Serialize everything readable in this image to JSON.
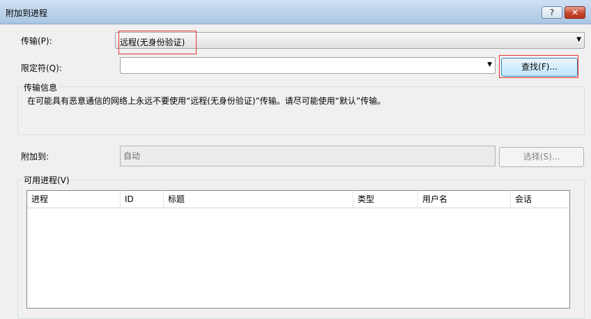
{
  "window": {
    "title": "附加到进程",
    "help_button": "?",
    "close_button": "✕"
  },
  "transport": {
    "label": "传输(P):",
    "value": "远程(无身份验证)"
  },
  "qualifier": {
    "label": "限定符(Q):",
    "value": "",
    "find_button": "查找(F)..."
  },
  "transport_info": {
    "group_title": "传输信息",
    "text": "在可能具有恶意通信的网络上永远不要使用“远程(无身份验证)”传输。请尽可能使用“默认”传输。"
  },
  "attach_to": {
    "label": "附加到:",
    "value": "自动",
    "select_button": "选择(S)..."
  },
  "processes": {
    "group_title": "可用进程(V)",
    "columns": [
      "进程",
      "ID",
      "标题",
      "类型",
      "用户名",
      "会话"
    ]
  },
  "colors": {
    "highlight_border": "#e8322d",
    "titlebar": "#b9d1ea"
  }
}
